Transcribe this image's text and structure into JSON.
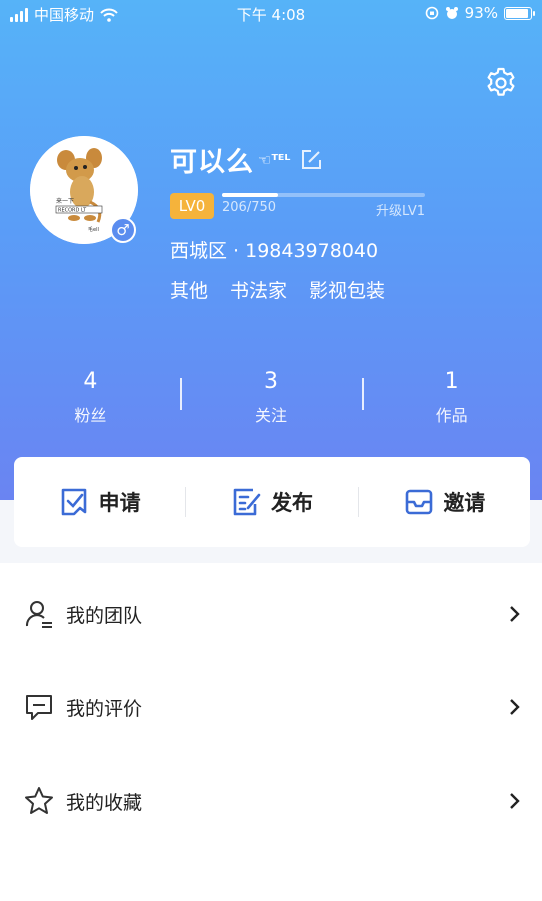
{
  "status_bar": {
    "carrier": "中国移动",
    "time": "下午 4:08",
    "battery": "93%",
    "battery_level": 0.93
  },
  "profile": {
    "nickname": "可以么",
    "name_suffix": "☜ᵀᴱᴸ",
    "level_badge": "LV0",
    "exp_text": "206/750",
    "exp_progress": 0.2747,
    "next_level": "升级LV1",
    "location": "西城区 · 19843978040",
    "tags": [
      "其他",
      "书法家",
      "影视包装"
    ],
    "gender_symbol": "♂",
    "avatar_lines": [
      "来一下",
      "RECORD LT",
      "毛ell"
    ]
  },
  "stats": [
    {
      "value": "4",
      "label": "粉丝"
    },
    {
      "value": "3",
      "label": "关注"
    },
    {
      "value": "1",
      "label": "作品"
    }
  ],
  "actions": [
    {
      "label": "申请",
      "icon": "apply-icon"
    },
    {
      "label": "发布",
      "icon": "publish-icon"
    },
    {
      "label": "邀请",
      "icon": "invite-icon"
    }
  ],
  "menu": [
    {
      "label": "我的团队",
      "icon": "team-icon"
    },
    {
      "label": "我的评价",
      "icon": "comment-icon"
    },
    {
      "label": "我的收藏",
      "icon": "star-icon"
    }
  ],
  "colors": {
    "hero_top": "#56b3f8",
    "hero_bottom": "#6a84f2",
    "level_badge": "#f5b33b",
    "action_icon": "#3b6bd6"
  }
}
